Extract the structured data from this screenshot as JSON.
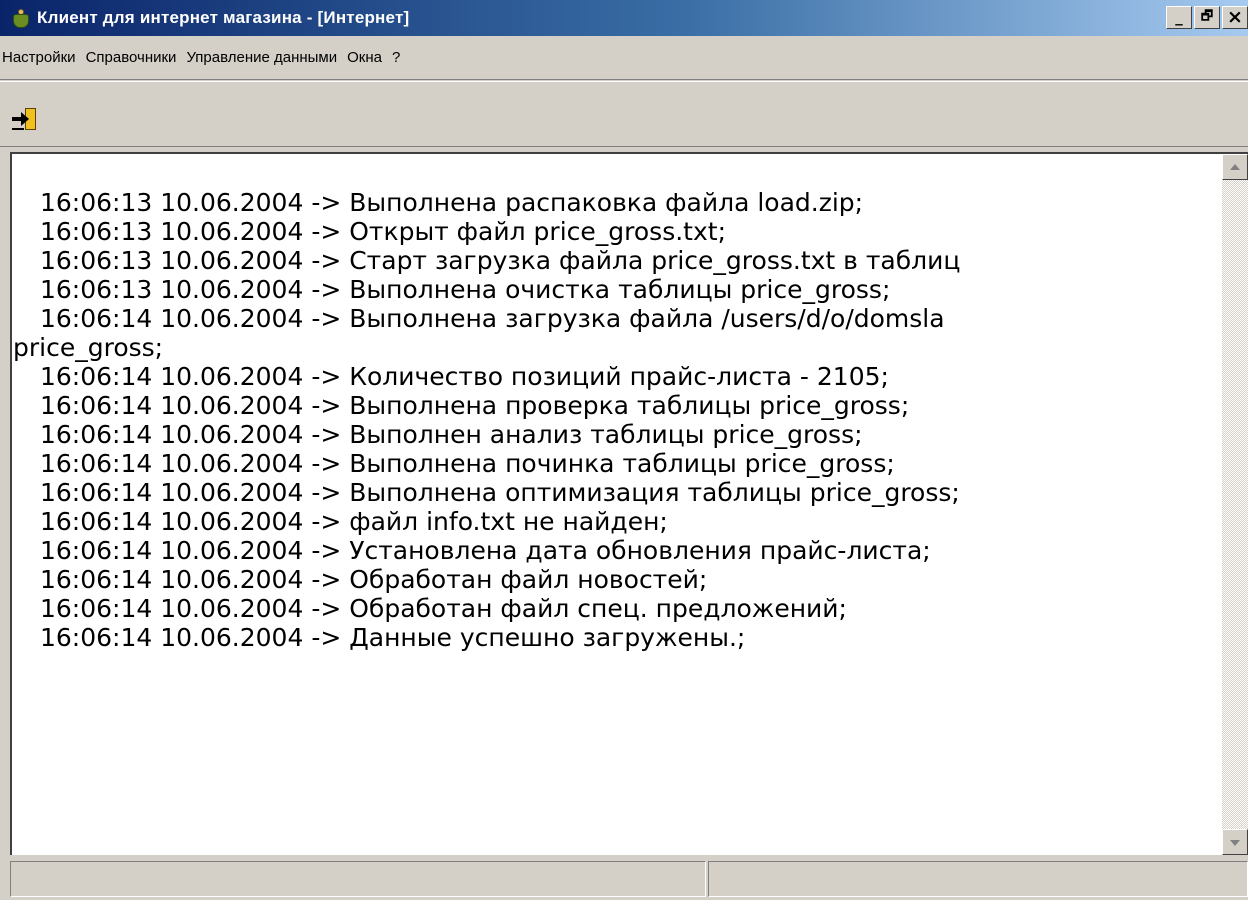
{
  "window": {
    "title": "Клиент для интернет магазина - [Интернет]",
    "icon": "shopping-bag-icon",
    "buttons": {
      "minimize": "_",
      "restore": "🗗",
      "close": "×"
    }
  },
  "menu": [
    {
      "label": "Настройки"
    },
    {
      "label": "Справочники"
    },
    {
      "label": "Управление данными"
    },
    {
      "label": "Окна"
    },
    {
      "label": "?"
    }
  ],
  "toolbar": {
    "exit_icon": "exit-door-icon"
  },
  "log": {
    "lines": [
      "16:06:13 10.06.2004 -> Выполнена распаковка файла load.zip;",
      "16:06:13 10.06.2004 -> Открыт файл price_gross.txt;",
      "16:06:13 10.06.2004 -> Старт загрузка файла price_gross.txt в таблиц",
      "16:06:13 10.06.2004 -> Выполнена очистка таблицы price_gross;",
      "16:06:14 10.06.2004 -> Выполнена загрузка файла /users/d/o/domsla",
      "price_gross;",
      "16:06:14 10.06.2004 -> Количество позиций прайс-листа - 2105;",
      "16:06:14 10.06.2004 -> Выполнена проверка таблицы price_gross;",
      "16:06:14 10.06.2004 -> Выполнен анализ таблицы price_gross;",
      "16:06:14 10.06.2004 -> Выполнена починка таблицы price_gross;",
      "16:06:14 10.06.2004 -> Выполнена оптимизация таблицы price_gross;",
      "16:06:14 10.06.2004 -> файл info.txt не найден;",
      "16:06:14 10.06.2004 -> Установлена дата обновления прайс-листа;",
      "16:06:14 10.06.2004 -> Обработан файл новостей;",
      "16:06:14 10.06.2004 -> Обработан файл спец. предложений;",
      "16:06:14 10.06.2004 -> Данные успешно загружены.;"
    ]
  },
  "status": {
    "panel1": "",
    "panel2": ""
  }
}
